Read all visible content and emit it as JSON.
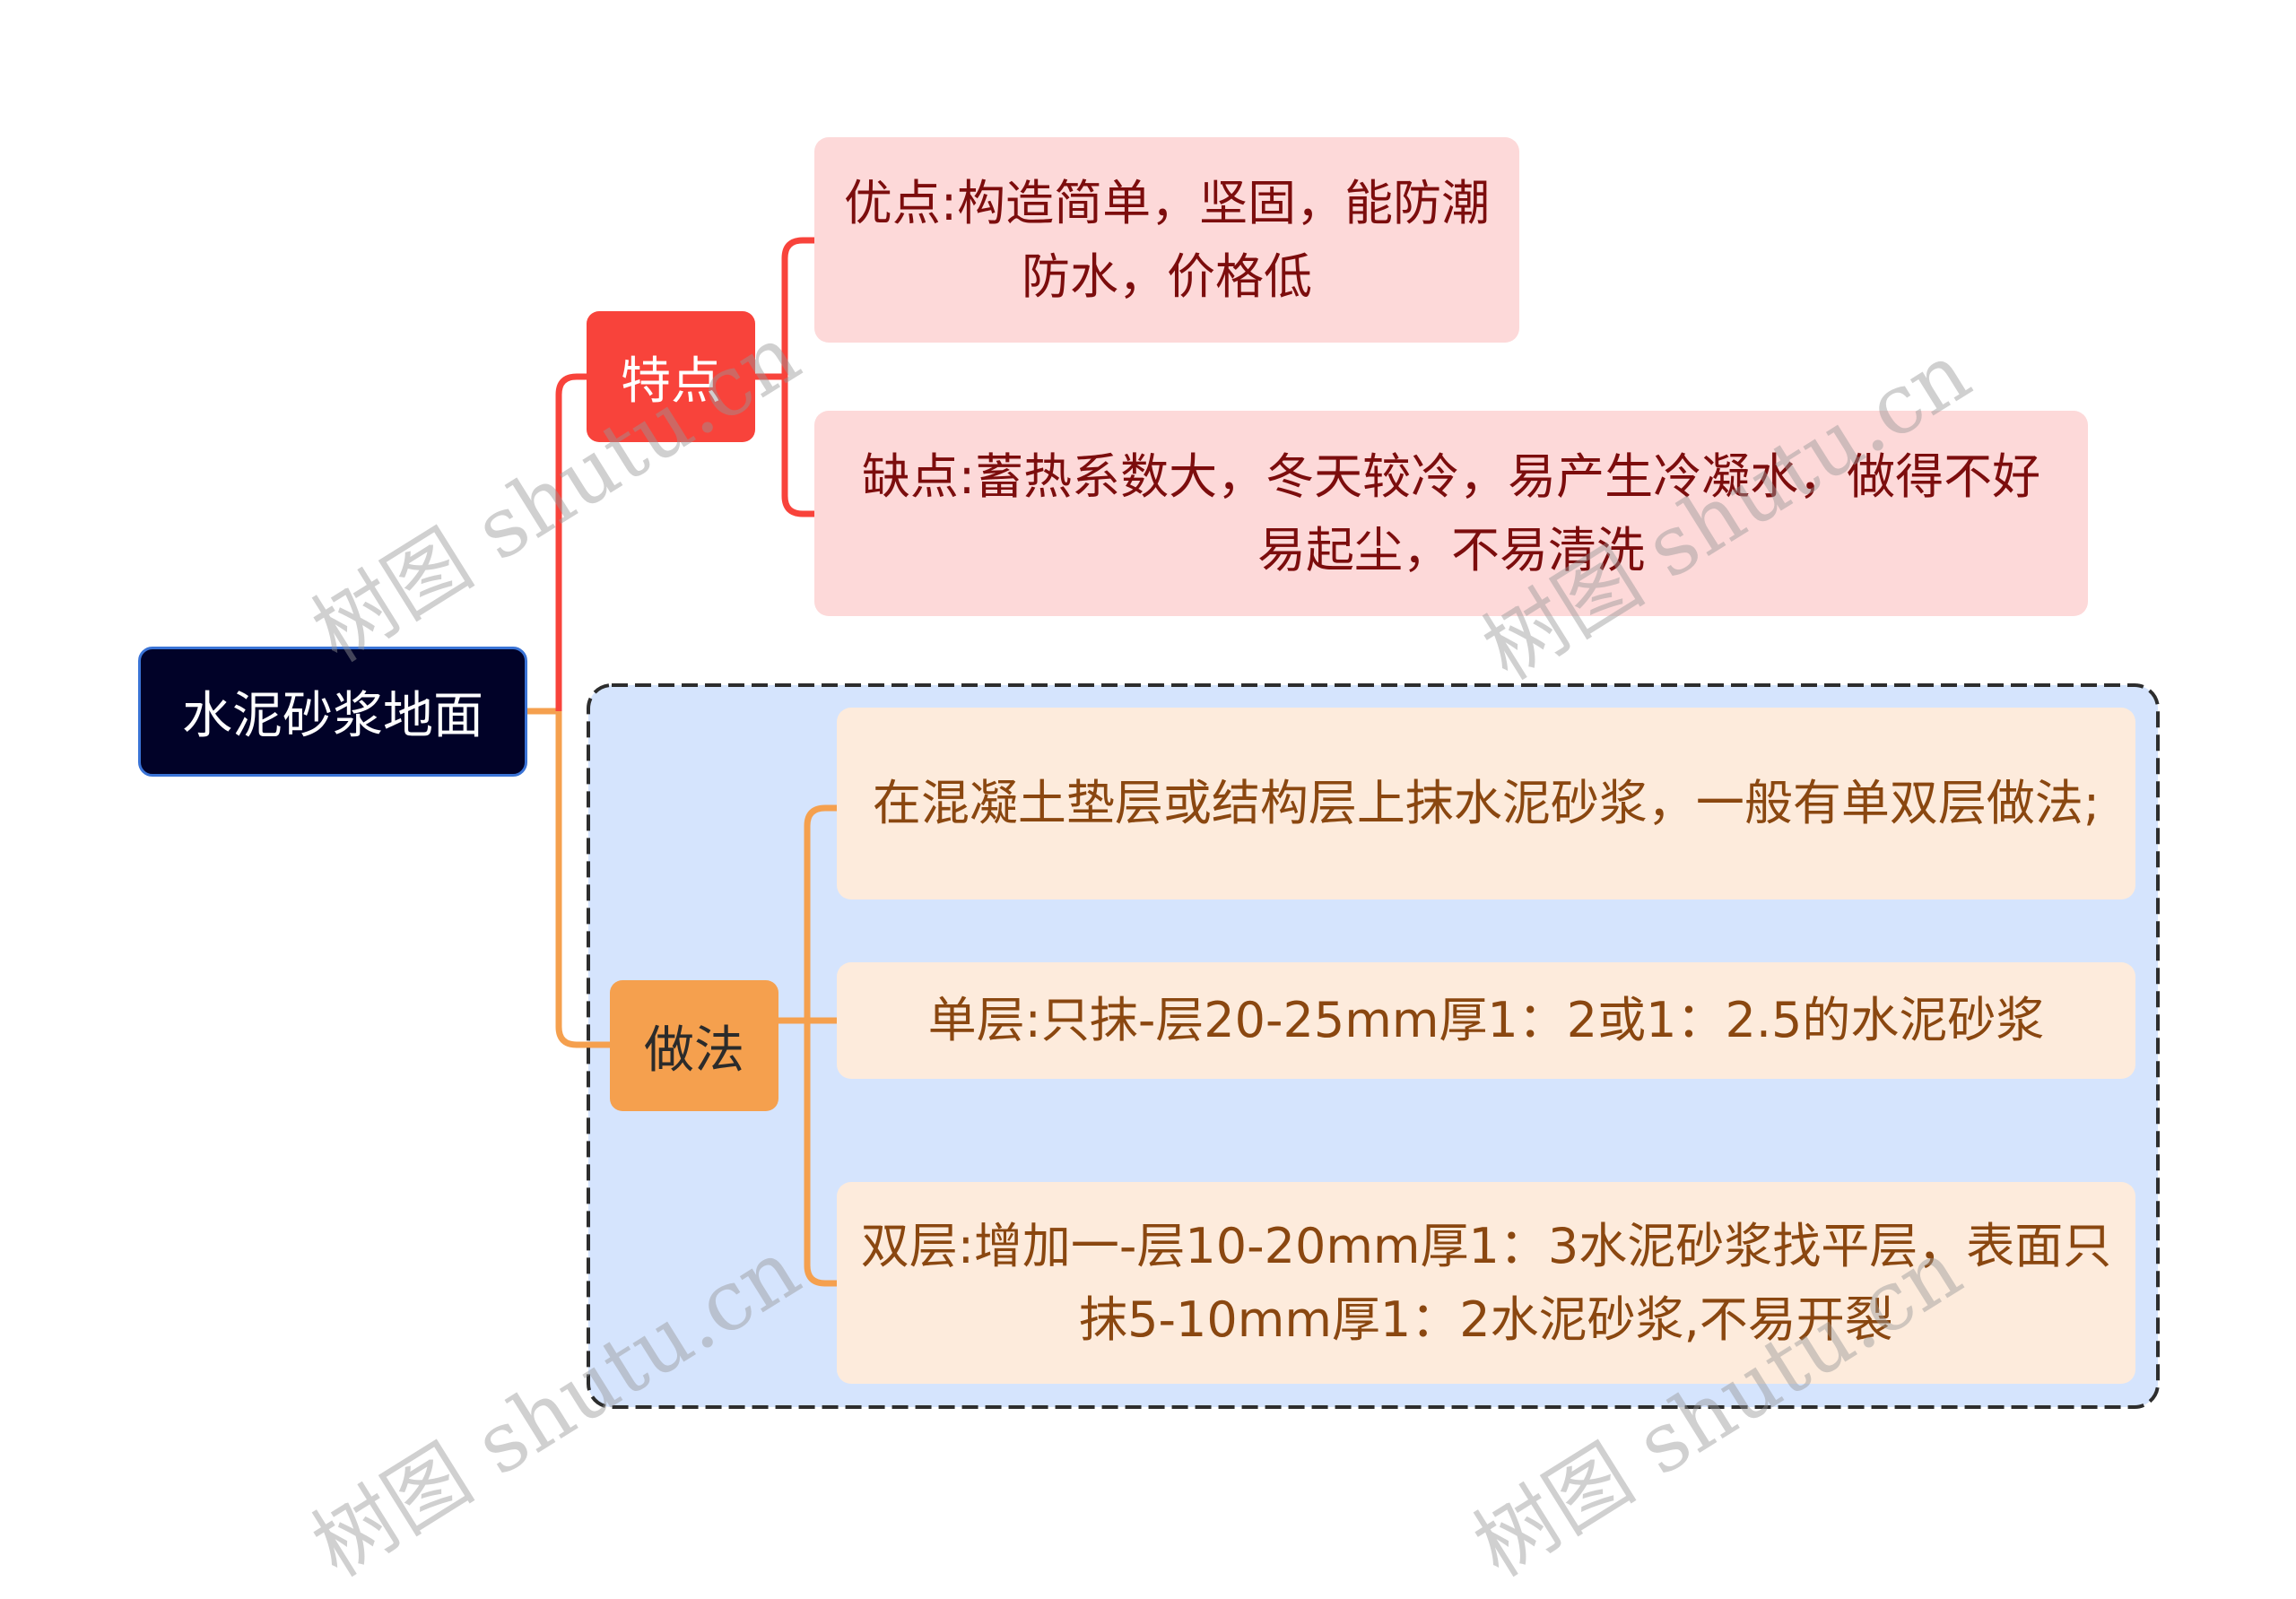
{
  "mindmap": {
    "root": {
      "label": "水泥砂浆地面"
    },
    "branches": [
      {
        "label": "特点",
        "color": "#f8433b",
        "children": [
          {
            "label": "优点:构造简单，坚固，能防潮防水，价格低"
          },
          {
            "label": "缺点:蓄热系数大，冬天较冷，易产生冷凝水，做得不好易起尘，不易清洗"
          }
        ]
      },
      {
        "label": "做法",
        "color": "#f5a04e",
        "grouped": true,
        "children": [
          {
            "label": "在混凝土垫层或结构层上抹水泥砂浆，一般有单双层做法;"
          },
          {
            "label": "单层:只抹-层20-25mm厚1：2或1：2.5的水泥砂浆"
          },
          {
            "label": "双层:增加一-层10-20mm厚1：3水泥砂浆找平层，表面只抹5-10mm厚1：2水泥砂浆,不易开裂"
          }
        ]
      }
    ]
  },
  "colors": {
    "root_bg": "#010228",
    "root_border": "#3a73d6",
    "red_leaf_bg": "#fdd9d9",
    "orange_leaf_bg": "#fdebdc",
    "group_bg": "#d5e4fd",
    "group_border": "#2d2d2d"
  },
  "watermark": {
    "text": "树图 shutu.cn"
  }
}
